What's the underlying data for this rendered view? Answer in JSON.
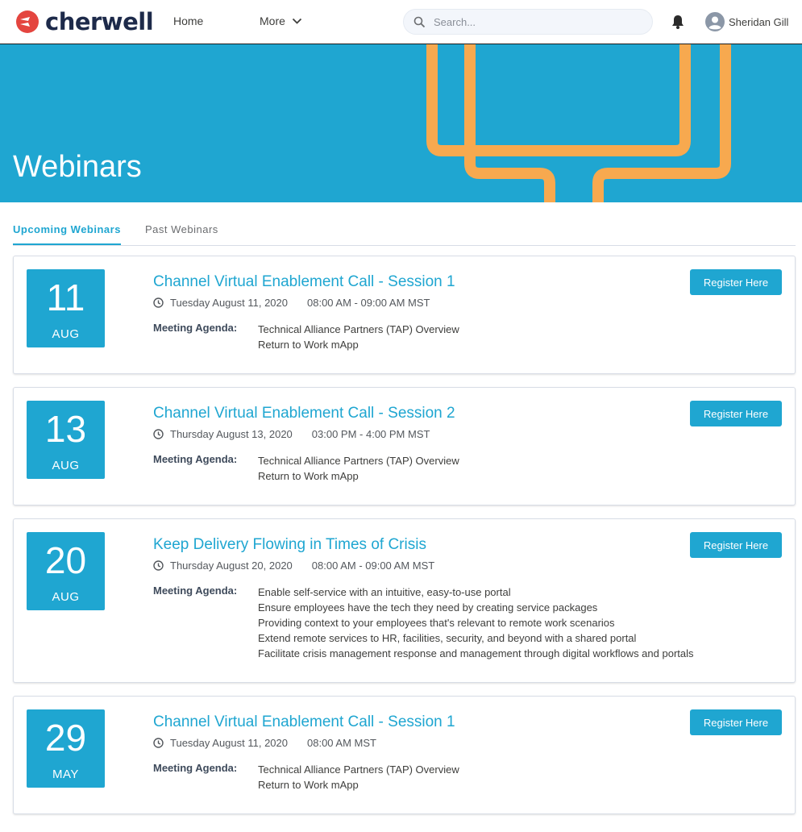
{
  "header": {
    "logo_text": "cherwell",
    "nav": {
      "home": "Home",
      "more": "More"
    },
    "search": {
      "placeholder": "Search..."
    },
    "user": {
      "name": "Sheridan Gill"
    }
  },
  "hero": {
    "title": "Webinars"
  },
  "tabs": [
    {
      "label": "Upcoming Webinars",
      "active": true
    },
    {
      "label": "Past Webinars",
      "active": false
    }
  ],
  "register_label": "Register Here",
  "agenda_label": "Meeting Agenda:",
  "webinars": [
    {
      "day": "11",
      "month": "AUG",
      "title": "Channel Virtual Enablement Call - Session 1",
      "date": "Tuesday August 11, 2020",
      "time": "08:00 AM - 09:00 AM MST",
      "agenda": [
        "Technical Alliance Partners (TAP) Overview",
        "Return to Work mApp"
      ]
    },
    {
      "day": "13",
      "month": "AUG",
      "title": "Channel Virtual Enablement Call - Session 2",
      "date": "Thursday August 13, 2020",
      "time": "03:00 PM - 4:00 PM MST",
      "agenda": [
        "Technical Alliance Partners (TAP) Overview",
        "Return to Work mApp"
      ]
    },
    {
      "day": "20",
      "month": "AUG",
      "title": "Keep Delivery Flowing in Times of Crisis",
      "date": "Thursday August 20, 2020",
      "time": "08:00 AM - 09:00 AM MST",
      "agenda": [
        "Enable self-service with an intuitive, easy-to-use portal",
        "Ensure employees have the tech they need by creating service packages",
        "Providing context to your employees that's relevant to remote work scenarios",
        "Extend remote services to HR, facilities, security, and beyond with a shared portal",
        "Facilitate crisis management response and management through digital workflows and portals"
      ]
    },
    {
      "day": "29",
      "month": "MAY",
      "title": "Channel Virtual Enablement Call - Session 1",
      "date": "Tuesday August 11, 2020",
      "time": "08:00 AM MST",
      "agenda": [
        "Technical Alliance Partners (TAP) Overview",
        "Return to Work mApp"
      ]
    }
  ],
  "colors": {
    "accent": "#1fa6d1",
    "brand_red": "#e4453f",
    "hero_art": "#f7a94f"
  }
}
